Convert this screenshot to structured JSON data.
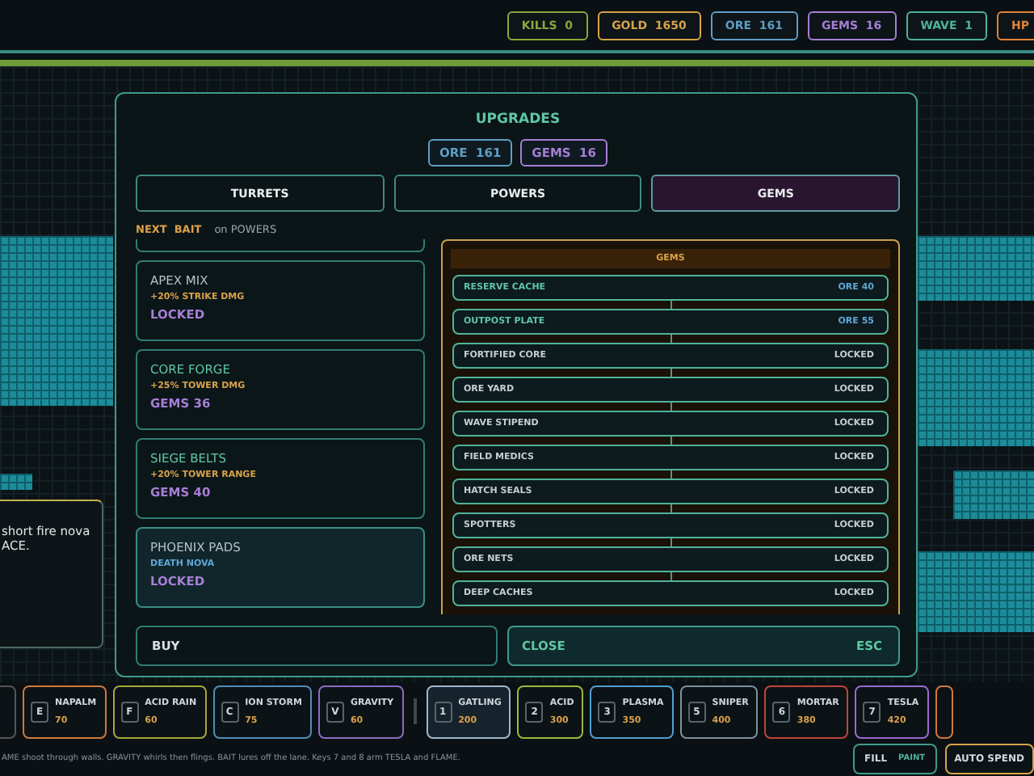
{
  "hud": [
    {
      "label": "KILLS",
      "value": "0",
      "color": "#8aa83c"
    },
    {
      "label": "GOLD",
      "value": "1650",
      "color": "#d9a24a"
    },
    {
      "label": "ORE",
      "value": "161",
      "color": "#5f9ec4"
    },
    {
      "label": "GEMS",
      "value": "16",
      "color": "#a77ed6"
    },
    {
      "label": "WAVE",
      "value": "1",
      "color": "#4fb39a"
    },
    {
      "label": "HP",
      "color": "#e0833a"
    }
  ],
  "tooltip": {
    "lines": [
      "short fire nova",
      "ACE."
    ]
  },
  "modal": {
    "title": "UPGRADES",
    "chips": [
      {
        "label": "ORE",
        "value": "161",
        "color": "#5f9ec4"
      },
      {
        "label": "GEMS",
        "value": "16",
        "color": "#a77ed6"
      }
    ],
    "tabs": [
      {
        "label": "TURRETS",
        "selected": false
      },
      {
        "label": "POWERS",
        "selected": false
      },
      {
        "label": "GEMS",
        "selected": true
      }
    ],
    "next_label": "NEXT  BAIT",
    "next_text": "on POWERS",
    "cards": [
      {
        "title": "APEX MIX",
        "effect": "+20% STRIKE DMG",
        "kind": "stat",
        "price": "LOCKED",
        "locked": true,
        "selected": false
      },
      {
        "title": "CORE FORGE",
        "effect": "+25% TOWER DMG",
        "kind": "stat",
        "price": "GEMS  36",
        "locked": false,
        "selected": false
      },
      {
        "title": "SIEGE BELTS",
        "effect": "+20% TOWER RANGE",
        "kind": "stat",
        "price": "GEMS  40",
        "locked": false,
        "selected": false
      },
      {
        "title": "PHOENIX PADS",
        "effect": "DEATH NOVA",
        "kind": "power",
        "price": "LOCKED",
        "locked": true,
        "selected": true
      }
    ],
    "tree": {
      "title": "GEMS",
      "rows": [
        {
          "name": "RESERVE CACHE",
          "cost": "ORE  40",
          "locked": false
        },
        {
          "name": "OUTPOST PLATE",
          "cost": "ORE  55",
          "locked": false
        },
        {
          "name": "FORTIFIED CORE",
          "cost": "LOCKED",
          "locked": true
        },
        {
          "name": "ORE YARD",
          "cost": "LOCKED",
          "locked": true
        },
        {
          "name": "WAVE STIPEND",
          "cost": "LOCKED",
          "locked": true
        },
        {
          "name": "FIELD MEDICS",
          "cost": "LOCKED",
          "locked": true
        },
        {
          "name": "HATCH SEALS",
          "cost": "LOCKED",
          "locked": true
        },
        {
          "name": "SPOTTERS",
          "cost": "LOCKED",
          "locked": true
        },
        {
          "name": "ORE NETS",
          "cost": "LOCKED",
          "locked": true
        },
        {
          "name": "DEEP CACHES",
          "cost": "LOCKED",
          "locked": true
        }
      ]
    },
    "buy": "BUY",
    "close": "CLOSE",
    "close_key": "ESC"
  },
  "powers": [
    {
      "key": "E",
      "name": "NAPALM",
      "cost": "70",
      "color": "#d0793a",
      "selected": false
    },
    {
      "key": "F",
      "name": "ACID RAIN",
      "cost": "60",
      "color": "#a7a63a",
      "selected": false
    },
    {
      "key": "C",
      "name": "ION STORM",
      "cost": "75",
      "color": "#4f8fb8",
      "selected": false
    },
    {
      "key": "V",
      "name": "GRAVITY",
      "cost": "60",
      "color": "#8b6cc0",
      "selected": false
    }
  ],
  "turrets": [
    {
      "key": "1",
      "name": "GATLING",
      "cost": "200",
      "color": "#9fb8d0",
      "selected": true
    },
    {
      "key": "2",
      "name": "ACID",
      "cost": "300",
      "color": "#9fb83a",
      "selected": false
    },
    {
      "key": "3",
      "name": "PLASMA",
      "cost": "350",
      "color": "#4f9fd0",
      "selected": false
    },
    {
      "key": "5",
      "name": "SNIPER",
      "cost": "400",
      "color": "#7d8fa0",
      "selected": false
    },
    {
      "key": "6",
      "name": "MORTAR",
      "cost": "380",
      "color": "#c0453a",
      "selected": false
    },
    {
      "key": "7",
      "name": "TESLA",
      "cost": "420",
      "color": "#9a6ad0",
      "selected": false
    }
  ],
  "hint": "AME shoot through walls. GRAVITY whirls then flings. BAIT lures off the lane. Keys 7 and 8 arm TESLA and FLAME.",
  "fill": {
    "label": "FILL",
    "mode": "PAINT"
  },
  "auto_spend": "AUTO SPEND"
}
